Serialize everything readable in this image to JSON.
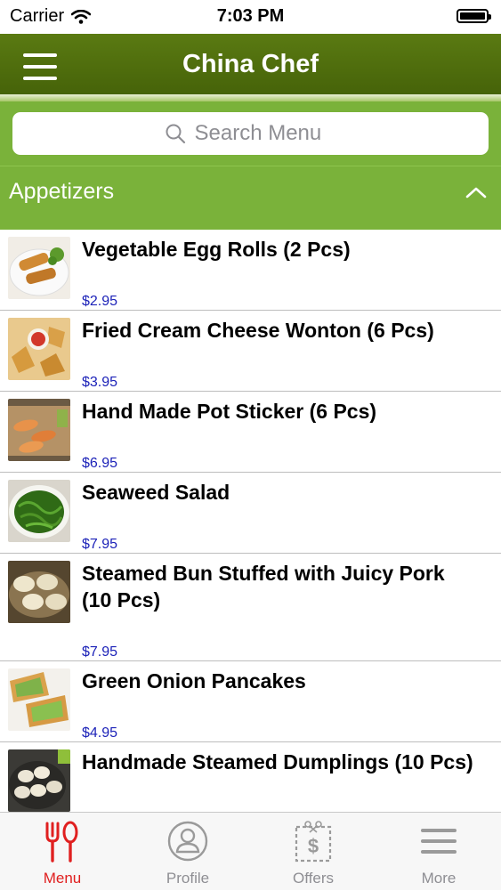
{
  "status_bar": {
    "carrier": "Carrier",
    "time": "7:03 PM"
  },
  "nav": {
    "title": "China Chef"
  },
  "search": {
    "placeholder": "Search Menu"
  },
  "category": {
    "title": "Appetizers"
  },
  "items": [
    {
      "name": "Vegetable Egg Rolls (2 Pcs)",
      "price": "$2.95"
    },
    {
      "name": "Fried Cream Cheese Wonton (6 Pcs)",
      "price": "$3.95"
    },
    {
      "name": "Hand Made Pot Sticker (6 Pcs)",
      "price": "$6.95"
    },
    {
      "name": "Seaweed Salad",
      "price": "$7.95"
    },
    {
      "name": "Steamed Bun Stuffed with Juicy Pork (10 Pcs)",
      "price": "$7.95"
    },
    {
      "name": "Green Onion Pancakes",
      "price": "$4.95"
    },
    {
      "name": "Handmade Steamed Dumplings (10 Pcs)",
      "price": ""
    }
  ],
  "tabs": [
    {
      "label": "Menu",
      "icon": "fork-spoon-icon"
    },
    {
      "label": "Profile",
      "icon": "profile-icon"
    },
    {
      "label": "Offers",
      "icon": "coupon-icon"
    },
    {
      "label": "More",
      "icon": "more-menu-icon"
    }
  ],
  "colors": {
    "nav_bar": "#4f6d0d",
    "accent_green": "#7ab23a",
    "price": "#1c22b8",
    "active_tab": "#e02020",
    "inactive_tab": "#8e8e93"
  }
}
